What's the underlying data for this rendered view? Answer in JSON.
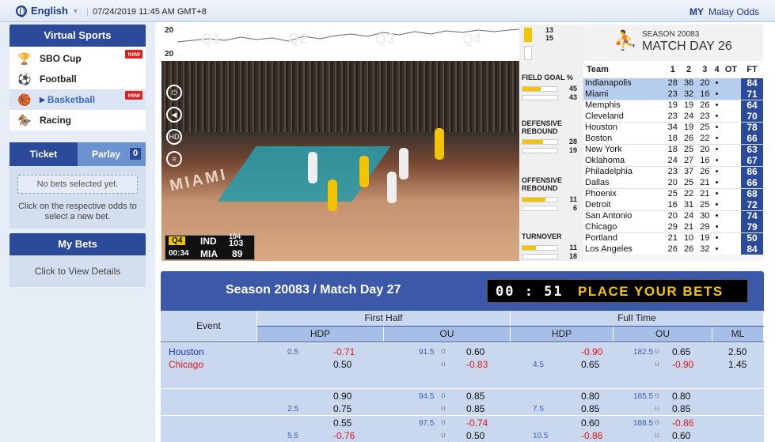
{
  "topbar": {
    "language": "English",
    "datetime": "07/24/2019 11:45 AM GMT+8",
    "my_label": "MY",
    "odds_type": "Malay Odds"
  },
  "virtual_sports": {
    "title": "Virtual Sports",
    "items": [
      {
        "label": "SBO Cup",
        "badge": "new"
      },
      {
        "label": "Football",
        "badge": ""
      },
      {
        "label": "Basketball",
        "badge": "new"
      },
      {
        "label": "Racing",
        "badge": ""
      }
    ]
  },
  "ticket": {
    "tab_ticket": "Ticket",
    "tab_parlay": "Parlay",
    "parlay_count": "0",
    "no_bets": "No bets selected yet.",
    "hint": "Click on the respective odds to select a new bet."
  },
  "mybets": {
    "title": "My Bets",
    "link": "Click to View Details"
  },
  "video": {
    "graph_top": "20",
    "graph_bottom": "20",
    "graph_quarters": [
      "Q1",
      "Q2",
      "Q3",
      "Q4"
    ],
    "score_top": "13",
    "score_bottom": "15",
    "quarter": "Q4",
    "clock": "00:34",
    "team1": "IND",
    "score1": "104",
    "team1_partial": "103",
    "team2": "MIA",
    "score2": "89",
    "court_text": "MIAMI"
  },
  "stats": [
    {
      "label": "FIELD GOAL %",
      "top": "45",
      "bottom": "43",
      "fill_top": 0.52,
      "fill_bottom": 0.48
    },
    {
      "label": "DEFENSIVE REBOUND",
      "top": "28",
      "bottom": "19",
      "fill_top": 0.6,
      "fill_bottom": 0.4
    },
    {
      "label": "OFFENSIVE REBOUND",
      "top": "11",
      "bottom": "6",
      "fill_top": 0.65,
      "fill_bottom": 0.35
    },
    {
      "label": "TURNOVER",
      "top": "11",
      "bottom": "18",
      "fill_top": 0.38,
      "fill_bottom": 0.62
    }
  ],
  "results": {
    "season": "SEASON 20083",
    "match_day": "MATCH DAY 26",
    "headers": [
      "Team",
      "1",
      "2",
      "3",
      "4",
      "OT",
      "FT"
    ],
    "games": [
      [
        {
          "team": "Indianapolis",
          "q": [
            "28",
            "36",
            "20",
            "•"
          ],
          "ot": "",
          "ft": "84"
        },
        {
          "team": "Miami",
          "q": [
            "23",
            "32",
            "16",
            "•"
          ],
          "ot": "",
          "ft": "71"
        }
      ],
      [
        {
          "team": "Memphis",
          "q": [
            "19",
            "19",
            "26",
            "•"
          ],
          "ot": "",
          "ft": "64"
        },
        {
          "team": "Cleveland",
          "q": [
            "23",
            "24",
            "23",
            "•"
          ],
          "ot": "",
          "ft": "70"
        }
      ],
      [
        {
          "team": "Houston",
          "q": [
            "34",
            "19",
            "25",
            "•"
          ],
          "ot": "",
          "ft": "78"
        },
        {
          "team": "Boston",
          "q": [
            "18",
            "26",
            "22",
            "•"
          ],
          "ot": "",
          "ft": "66"
        }
      ],
      [
        {
          "team": "New York",
          "q": [
            "18",
            "25",
            "20",
            "•"
          ],
          "ot": "",
          "ft": "63"
        },
        {
          "team": "Oklahoma",
          "q": [
            "24",
            "27",
            "16",
            "•"
          ],
          "ot": "",
          "ft": "67"
        }
      ],
      [
        {
          "team": "Philadelphia",
          "q": [
            "23",
            "37",
            "26",
            "•"
          ],
          "ot": "",
          "ft": "86"
        },
        {
          "team": "Dallas",
          "q": [
            "20",
            "25",
            "21",
            "•"
          ],
          "ot": "",
          "ft": "66"
        }
      ],
      [
        {
          "team": "Phoenix",
          "q": [
            "25",
            "22",
            "21",
            "•"
          ],
          "ot": "",
          "ft": "68"
        },
        {
          "team": "Detroit",
          "q": [
            "16",
            "31",
            "25",
            "•"
          ],
          "ot": "",
          "ft": "72"
        }
      ],
      [
        {
          "team": "San Antonio",
          "q": [
            "20",
            "24",
            "30",
            "•"
          ],
          "ot": "",
          "ft": "74"
        },
        {
          "team": "Chicago",
          "q": [
            "29",
            "21",
            "29",
            "•"
          ],
          "ot": "",
          "ft": "79"
        }
      ],
      [
        {
          "team": "Portland",
          "q": [
            "21",
            "10",
            "19",
            "•"
          ],
          "ot": "",
          "ft": "50"
        },
        {
          "team": "Los Angeles",
          "q": [
            "26",
            "26",
            "32",
            "•"
          ],
          "ot": "",
          "ft": "84"
        }
      ]
    ]
  },
  "market": {
    "title": "Season 20083 / Match Day 27",
    "timer": "00 : 51",
    "place_bets": "PLACE YOUR BETS",
    "col_event": "Event",
    "col_first_half": "First Half",
    "col_full_time": "Full Time",
    "col_hdp": "HDP",
    "col_ou": "OU",
    "col_ml": "ML",
    "team_home": "Houston",
    "team_away": "Chicago",
    "over": "o",
    "under": "u",
    "rows": [
      {
        "fh_hdp_line_a": "0.5",
        "fh_hdp_line_b": "",
        "fh_hdp_a": "-0.71",
        "fh_hdp_b": "0.50",
        "fh_ou_line": "91.5",
        "fh_ou_o": "0.60",
        "fh_ou_u": "-0.83",
        "ft_hdp_line_a": "",
        "ft_hdp_line_b": "4.5",
        "ft_hdp_a": "-0.90",
        "ft_hdp_b": "0.65",
        "ft_ou_line": "182.5",
        "ft_ou_o": "0.65",
        "ft_ou_u": "-0.90",
        "ml_a": "2.50",
        "ml_b": "1.45"
      },
      {
        "fh_hdp_line_a": "",
        "fh_hdp_line_b": "2.5",
        "fh_hdp_a": "0.90",
        "fh_hdp_b": "0.75",
        "fh_ou_line": "94.5",
        "fh_ou_o": "0.85",
        "fh_ou_u": "0.85",
        "ft_hdp_line_a": "",
        "ft_hdp_line_b": "7.5",
        "ft_hdp_a": "0.80",
        "ft_hdp_b": "0.85",
        "ft_ou_line": "185.5",
        "ft_ou_o": "0.80",
        "ft_ou_u": "0.85",
        "ml_a": "",
        "ml_b": ""
      },
      {
        "fh_hdp_line_a": "",
        "fh_hdp_line_b": "5.5",
        "fh_hdp_a": "0.55",
        "fh_hdp_b": "-0.76",
        "fh_ou_line": "97.5",
        "fh_ou_o": "-0.74",
        "fh_ou_u": "0.50",
        "ft_hdp_line_a": "",
        "ft_hdp_line_b": "10.5",
        "ft_hdp_a": "0.60",
        "ft_hdp_b": "-0.86",
        "ft_ou_line": "188.5",
        "ft_ou_o": "-0.86",
        "ft_ou_u": "0.60",
        "ml_a": "",
        "ml_b": ""
      }
    ]
  },
  "colors": {
    "brand": "#2c4a9a",
    "negative": "#e01818",
    "accent": "#f5c400"
  }
}
